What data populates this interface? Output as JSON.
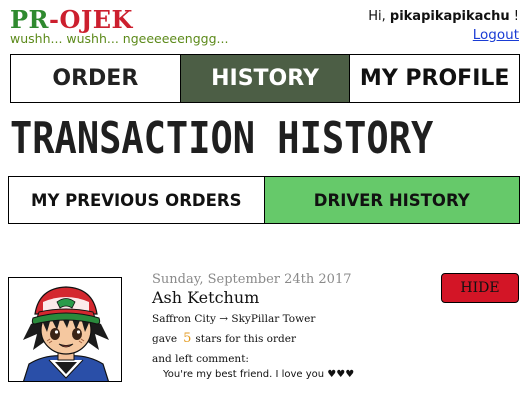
{
  "header": {
    "logo_pr": "PR",
    "logo_dash": "-",
    "logo_ojek": "OJEK",
    "tagline": "wushh... wushh... ngeeeeeenggg...",
    "greeting_prefix": "Hi, ",
    "username": "pikapikapikachu",
    "greeting_suffix": " !",
    "logout_label": "Logout"
  },
  "nav": {
    "tabs": [
      {
        "label": "ORDER"
      },
      {
        "label": "HISTORY"
      },
      {
        "label": "MY PROFILE"
      }
    ],
    "active": "HISTORY"
  },
  "page": {
    "title": "TRANSACTION HISTORY"
  },
  "subtabs": {
    "items": [
      {
        "label": "MY PREVIOUS ORDERS"
      },
      {
        "label": "DRIVER HISTORY"
      }
    ],
    "active": "DRIVER HISTORY"
  },
  "orders": [
    {
      "date": "Sunday, September 24th 2017",
      "name": "Ash Ketchum",
      "route": "Saffron City → SkyPillar Tower",
      "gave_prefix": "gave",
      "rating": "5",
      "gave_suffix": "stars for this order",
      "comment_label": "and left  comment:",
      "comment": "You're my best friend. I love you ♥♥♥",
      "hide_label": "HIDE",
      "avatar_icon": "ash-ketchum-avatar"
    }
  ],
  "colors": {
    "nav_active_bg": "#4c5e45",
    "subtab_active_bg": "#66c96a",
    "hide_button_bg": "#d31526",
    "logo_green": "#2f8a2f",
    "logo_red": "#cc1f2e",
    "rating_color": "#e39a1f",
    "link_color": "#1a3cd4"
  }
}
